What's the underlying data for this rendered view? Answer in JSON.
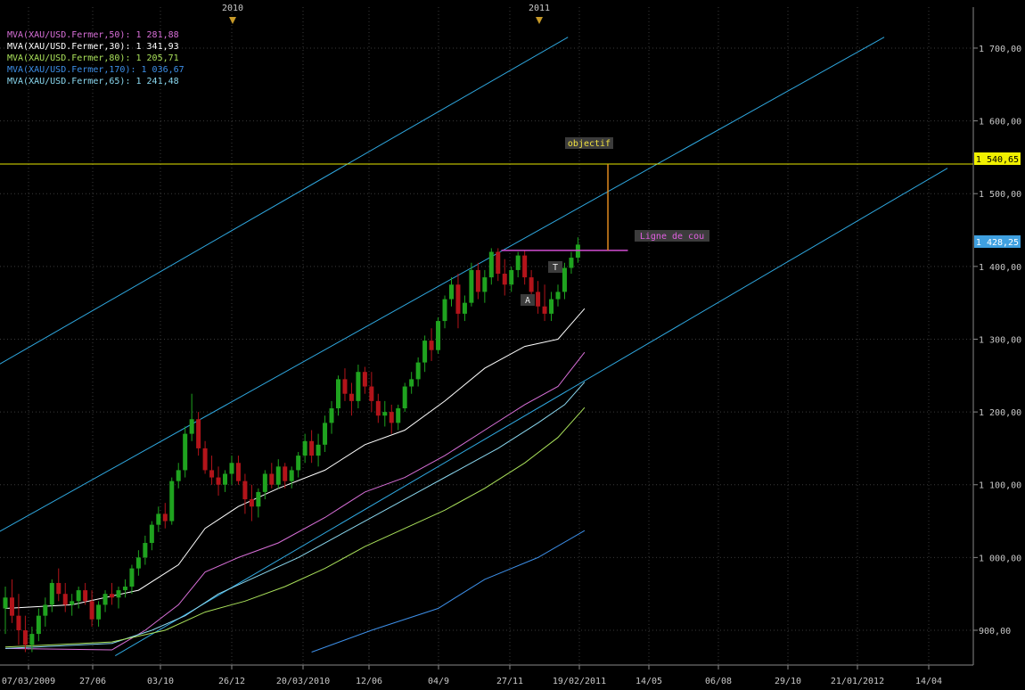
{
  "colors": {
    "background": "#000000",
    "grid": "#3a3a3a",
    "axis_text": "#c8c8c8",
    "candle_up": "#1fa31f",
    "candle_down": "#b3141a",
    "channel": "#2fa8e0",
    "objective_line": "#e6e600",
    "neckline": "#d24dd2",
    "objective_arrow": "#e08a1e",
    "label_box": "#3c3c3c",
    "year_marker": "#c89a28"
  },
  "legend": [
    {
      "text": "MVA(XAU/USD.Fermer,50): 1 281,88",
      "color": "#d86fd8"
    },
    {
      "text": "MVA(XAU/USD.Fermer,30): 1 341,93",
      "color": "#ffffff"
    },
    {
      "text": "MVA(XAU/USD.Fermer,80): 1 205,71",
      "color": "#a9e05a"
    },
    {
      "text": "MVA(XAU/USD.Fermer,170): 1 036,67",
      "color": "#3d8fe8"
    },
    {
      "text": "MVA(XAU/USD.Fermer,65): 1 241,48",
      "color": "#8ad8f0"
    }
  ],
  "price_badges": [
    {
      "text": "1 540,65",
      "value": 1540.65,
      "bg": "#f0f000",
      "fg": "#000000"
    },
    {
      "text": "1 428,25",
      "value": 1428.25,
      "bg": "#3fa0e0",
      "fg": "#ffffff"
    }
  ],
  "annotations": {
    "objectif": "objectif",
    "ligne": "Ligne de cou",
    "t": "T",
    "a": "A"
  },
  "chart_data": {
    "type": "candlestick",
    "instrument": "XAU/USD",
    "y_axis": {
      "ticks": [
        900,
        1000,
        1100,
        1200,
        1300,
        1400,
        1500,
        1600,
        1700
      ],
      "tick_labels": [
        "900,00",
        "1 000,00",
        "1 100,00",
        "1 200,00",
        "1 300,00",
        "1 400,00",
        "1 500,00",
        "1 600,00",
        "1 700,00"
      ],
      "range": [
        865,
        1725
      ]
    },
    "x_axis": {
      "tick_labels": [
        "07/03/2009",
        "27/06",
        "03/10",
        "26/12",
        "20/03/2010",
        "12/06",
        "04/9",
        "27/11",
        "19/02/2011",
        "14/05",
        "06/08",
        "29/10",
        "21/01/2012",
        "14/04"
      ],
      "year_markers": [
        "2010",
        "2011"
      ]
    },
    "candles": [
      {
        "o": 930,
        "h": 960,
        "l": 895,
        "c": 945
      },
      {
        "o": 945,
        "h": 970,
        "l": 910,
        "c": 920
      },
      {
        "o": 920,
        "h": 950,
        "l": 880,
        "c": 900
      },
      {
        "o": 900,
        "h": 920,
        "l": 870,
        "c": 880
      },
      {
        "o": 880,
        "h": 905,
        "l": 870,
        "c": 895
      },
      {
        "o": 895,
        "h": 930,
        "l": 885,
        "c": 920
      },
      {
        "o": 920,
        "h": 945,
        "l": 905,
        "c": 935
      },
      {
        "o": 935,
        "h": 970,
        "l": 925,
        "c": 965
      },
      {
        "o": 965,
        "h": 985,
        "l": 940,
        "c": 950
      },
      {
        "o": 950,
        "h": 965,
        "l": 925,
        "c": 935
      },
      {
        "o": 935,
        "h": 950,
        "l": 920,
        "c": 940
      },
      {
        "o": 940,
        "h": 960,
        "l": 930,
        "c": 955
      },
      {
        "o": 955,
        "h": 965,
        "l": 935,
        "c": 940
      },
      {
        "o": 940,
        "h": 955,
        "l": 905,
        "c": 915
      },
      {
        "o": 915,
        "h": 940,
        "l": 905,
        "c": 935
      },
      {
        "o": 935,
        "h": 955,
        "l": 925,
        "c": 950
      },
      {
        "o": 950,
        "h": 965,
        "l": 935,
        "c": 945
      },
      {
        "o": 945,
        "h": 960,
        "l": 930,
        "c": 955
      },
      {
        "o": 955,
        "h": 970,
        "l": 945,
        "c": 960
      },
      {
        "o": 960,
        "h": 990,
        "l": 950,
        "c": 985
      },
      {
        "o": 985,
        "h": 1010,
        "l": 975,
        "c": 1000
      },
      {
        "o": 1000,
        "h": 1030,
        "l": 990,
        "c": 1020
      },
      {
        "o": 1020,
        "h": 1050,
        "l": 1010,
        "c": 1045
      },
      {
        "o": 1045,
        "h": 1070,
        "l": 1035,
        "c": 1060
      },
      {
        "o": 1060,
        "h": 1075,
        "l": 1040,
        "c": 1050
      },
      {
        "o": 1050,
        "h": 1110,
        "l": 1045,
        "c": 1105
      },
      {
        "o": 1105,
        "h": 1130,
        "l": 1095,
        "c": 1120
      },
      {
        "o": 1120,
        "h": 1180,
        "l": 1110,
        "c": 1170
      },
      {
        "o": 1170,
        "h": 1225,
        "l": 1160,
        "c": 1190
      },
      {
        "o": 1190,
        "h": 1200,
        "l": 1140,
        "c": 1150
      },
      {
        "o": 1150,
        "h": 1160,
        "l": 1115,
        "c": 1120
      },
      {
        "o": 1120,
        "h": 1140,
        "l": 1100,
        "c": 1110
      },
      {
        "o": 1110,
        "h": 1125,
        "l": 1085,
        "c": 1100
      },
      {
        "o": 1100,
        "h": 1120,
        "l": 1090,
        "c": 1115
      },
      {
        "o": 1115,
        "h": 1140,
        "l": 1100,
        "c": 1130
      },
      {
        "o": 1130,
        "h": 1140,
        "l": 1100,
        "c": 1105
      },
      {
        "o": 1105,
        "h": 1115,
        "l": 1060,
        "c": 1080
      },
      {
        "o": 1080,
        "h": 1100,
        "l": 1050,
        "c": 1070
      },
      {
        "o": 1070,
        "h": 1095,
        "l": 1055,
        "c": 1090
      },
      {
        "o": 1090,
        "h": 1120,
        "l": 1080,
        "c": 1115
      },
      {
        "o": 1115,
        "h": 1130,
        "l": 1095,
        "c": 1100
      },
      {
        "o": 1100,
        "h": 1135,
        "l": 1095,
        "c": 1125
      },
      {
        "o": 1125,
        "h": 1130,
        "l": 1095,
        "c": 1105
      },
      {
        "o": 1105,
        "h": 1125,
        "l": 1095,
        "c": 1120
      },
      {
        "o": 1120,
        "h": 1145,
        "l": 1110,
        "c": 1140
      },
      {
        "o": 1140,
        "h": 1170,
        "l": 1130,
        "c": 1160
      },
      {
        "o": 1160,
        "h": 1175,
        "l": 1130,
        "c": 1140
      },
      {
        "o": 1140,
        "h": 1170,
        "l": 1125,
        "c": 1155
      },
      {
        "o": 1155,
        "h": 1195,
        "l": 1145,
        "c": 1185
      },
      {
        "o": 1185,
        "h": 1215,
        "l": 1170,
        "c": 1205
      },
      {
        "o": 1205,
        "h": 1250,
        "l": 1195,
        "c": 1245
      },
      {
        "o": 1245,
        "h": 1260,
        "l": 1215,
        "c": 1225
      },
      {
        "o": 1225,
        "h": 1240,
        "l": 1195,
        "c": 1215
      },
      {
        "o": 1215,
        "h": 1265,
        "l": 1205,
        "c": 1255
      },
      {
        "o": 1255,
        "h": 1262,
        "l": 1225,
        "c": 1235
      },
      {
        "o": 1235,
        "h": 1255,
        "l": 1200,
        "c": 1215
      },
      {
        "o": 1215,
        "h": 1225,
        "l": 1185,
        "c": 1195
      },
      {
        "o": 1195,
        "h": 1215,
        "l": 1180,
        "c": 1200
      },
      {
        "o": 1200,
        "h": 1210,
        "l": 1170,
        "c": 1185
      },
      {
        "o": 1185,
        "h": 1210,
        "l": 1175,
        "c": 1205
      },
      {
        "o": 1205,
        "h": 1240,
        "l": 1200,
        "c": 1235
      },
      {
        "o": 1235,
        "h": 1255,
        "l": 1225,
        "c": 1245
      },
      {
        "o": 1245,
        "h": 1275,
        "l": 1235,
        "c": 1268
      },
      {
        "o": 1268,
        "h": 1305,
        "l": 1255,
        "c": 1298
      },
      {
        "o": 1298,
        "h": 1315,
        "l": 1270,
        "c": 1285
      },
      {
        "o": 1285,
        "h": 1330,
        "l": 1280,
        "c": 1325
      },
      {
        "o": 1325,
        "h": 1360,
        "l": 1315,
        "c": 1355
      },
      {
        "o": 1355,
        "h": 1385,
        "l": 1345,
        "c": 1375
      },
      {
        "o": 1375,
        "h": 1390,
        "l": 1315,
        "c": 1335
      },
      {
        "o": 1335,
        "h": 1360,
        "l": 1325,
        "c": 1350
      },
      {
        "o": 1350,
        "h": 1405,
        "l": 1345,
        "c": 1395
      },
      {
        "o": 1395,
        "h": 1405,
        "l": 1355,
        "c": 1365
      },
      {
        "o": 1365,
        "h": 1395,
        "l": 1350,
        "c": 1385
      },
      {
        "o": 1385,
        "h": 1425,
        "l": 1375,
        "c": 1420
      },
      {
        "o": 1420,
        "h": 1425,
        "l": 1380,
        "c": 1390
      },
      {
        "o": 1390,
        "h": 1410,
        "l": 1360,
        "c": 1375
      },
      {
        "o": 1375,
        "h": 1400,
        "l": 1365,
        "c": 1395
      },
      {
        "o": 1395,
        "h": 1420,
        "l": 1385,
        "c": 1415
      },
      {
        "o": 1415,
        "h": 1422,
        "l": 1375,
        "c": 1385
      },
      {
        "o": 1385,
        "h": 1395,
        "l": 1355,
        "c": 1365
      },
      {
        "o": 1365,
        "h": 1380,
        "l": 1335,
        "c": 1345
      },
      {
        "o": 1345,
        "h": 1375,
        "l": 1325,
        "c": 1335
      },
      {
        "o": 1335,
        "h": 1365,
        "l": 1325,
        "c": 1355
      },
      {
        "o": 1355,
        "h": 1375,
        "l": 1345,
        "c": 1365
      },
      {
        "o": 1365,
        "h": 1405,
        "l": 1355,
        "c": 1398
      },
      {
        "o": 1398,
        "h": 1420,
        "l": 1390,
        "c": 1412
      },
      {
        "o": 1412,
        "h": 1440,
        "l": 1405,
        "c": 1430
      }
    ],
    "moving_averages": [
      {
        "name": "MVA(XAU/USD.Fermer,30)",
        "color": "#ffffff",
        "points": [
          [
            0,
            930
          ],
          [
            10,
            935
          ],
          [
            20,
            955
          ],
          [
            26,
            990
          ],
          [
            30,
            1040
          ],
          [
            35,
            1070
          ],
          [
            41,
            1095
          ],
          [
            48,
            1120
          ],
          [
            54,
            1155
          ],
          [
            60,
            1175
          ],
          [
            66,
            1215
          ],
          [
            72,
            1260
          ],
          [
            78,
            1290
          ],
          [
            83,
            1300
          ],
          [
            87,
            1342
          ]
        ]
      },
      {
        "name": "MVA(XAU/USD.Fermer,50)",
        "color": "#d86fd8",
        "points": [
          [
            0,
            875
          ],
          [
            16,
            873
          ],
          [
            21,
            900
          ],
          [
            26,
            935
          ],
          [
            30,
            980
          ],
          [
            35,
            1000
          ],
          [
            41,
            1020
          ],
          [
            48,
            1055
          ],
          [
            54,
            1090
          ],
          [
            60,
            1110
          ],
          [
            66,
            1140
          ],
          [
            72,
            1175
          ],
          [
            78,
            1210
          ],
          [
            83,
            1235
          ],
          [
            87,
            1282
          ]
        ]
      },
      {
        "name": "MVA(XAU/USD.Fermer,65)",
        "color": "#8ad8f0",
        "points": [
          [
            0,
            875
          ],
          [
            16,
            882
          ],
          [
            22,
            900
          ],
          [
            27,
            920
          ],
          [
            32,
            950
          ],
          [
            38,
            975
          ],
          [
            44,
            1000
          ],
          [
            50,
            1030
          ],
          [
            56,
            1060
          ],
          [
            62,
            1090
          ],
          [
            68,
            1120
          ],
          [
            74,
            1150
          ],
          [
            80,
            1185
          ],
          [
            84,
            1210
          ],
          [
            87,
            1241
          ]
        ]
      },
      {
        "name": "MVA(XAU/USD.Fermer,80)",
        "color": "#a9e05a",
        "points": [
          [
            0,
            877
          ],
          [
            16,
            884
          ],
          [
            24,
            900
          ],
          [
            30,
            925
          ],
          [
            36,
            940
          ],
          [
            42,
            960
          ],
          [
            48,
            985
          ],
          [
            54,
            1015
          ],
          [
            60,
            1040
          ],
          [
            66,
            1065
          ],
          [
            72,
            1095
          ],
          [
            78,
            1130
          ],
          [
            83,
            1165
          ],
          [
            87,
            1206
          ]
        ]
      },
      {
        "name": "MVA(XAU/USD.Fermer,170)",
        "color": "#3d8fe8",
        "points": [
          [
            46,
            870
          ],
          [
            55,
            900
          ],
          [
            65,
            930
          ],
          [
            72,
            970
          ],
          [
            80,
            1000
          ],
          [
            87,
            1037
          ]
        ]
      }
    ],
    "channel_lines": [
      {
        "name": "upper",
        "from": {
          "i": -1,
          "v": 1265
        },
        "to": {
          "i": 84.5,
          "v": 1715
        }
      },
      {
        "name": "middle",
        "from": {
          "i": -1,
          "v": 1035
        },
        "to": {
          "i": 132,
          "v": 1715
        }
      },
      {
        "name": "lower",
        "from": {
          "i": 16.5,
          "v": 865
        },
        "to": {
          "i": 141.5,
          "v": 1535
        }
      }
    ],
    "objective_level": 1540.65,
    "neckline": {
      "from_index": 74.5,
      "to_index": 93.5,
      "value": 1422
    },
    "objective_arrow": {
      "index": 90.5,
      "from": 1422,
      "to": 1540.65
    },
    "current_price": 1428.25
  }
}
